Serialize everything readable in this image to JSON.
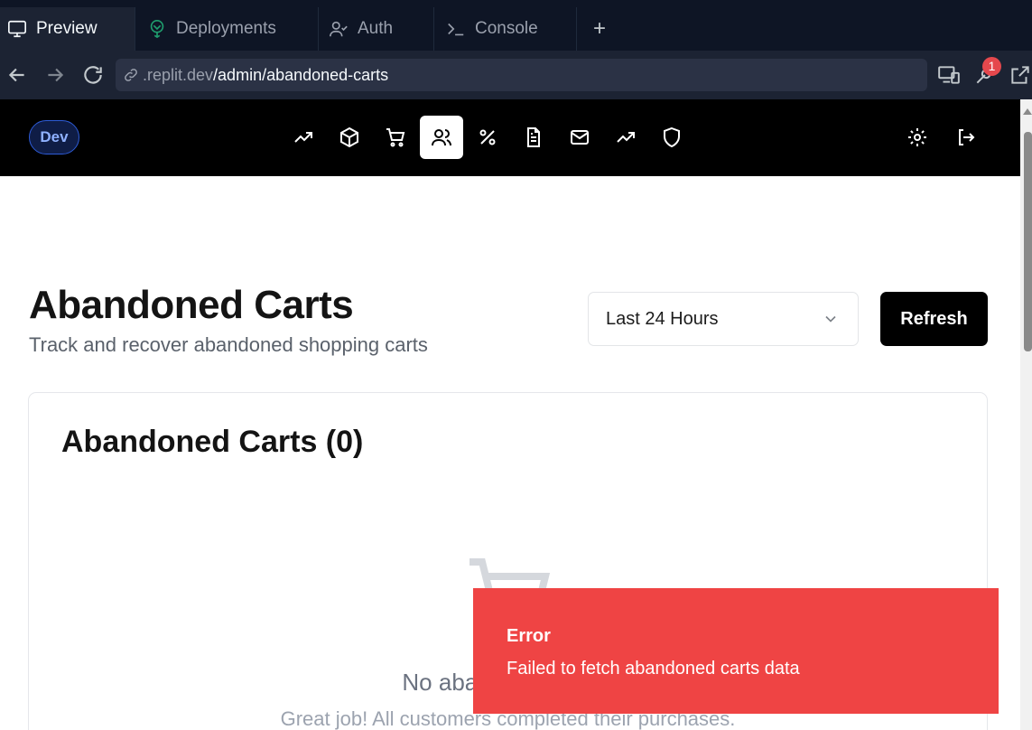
{
  "tabs": [
    {
      "label": "Preview",
      "icon": "monitor-icon",
      "active": true
    },
    {
      "label": "Deployments",
      "icon": "deploy-icon"
    },
    {
      "label": "Auth",
      "icon": "user-check-icon"
    },
    {
      "label": "Console",
      "icon": "terminal-icon"
    }
  ],
  "address": {
    "domain": ".replit.dev",
    "path": "/admin/abandoned-carts",
    "badge_count": "1"
  },
  "header": {
    "env_badge": "Dev",
    "nav_icons": [
      "trending-up-icon",
      "package-icon",
      "cart-icon",
      "users-icon",
      "percent-icon",
      "file-text-icon",
      "mail-icon",
      "trending-up-icon",
      "shield-icon"
    ],
    "active_nav": "users-icon"
  },
  "page": {
    "title": "Abandoned Carts",
    "subtitle": "Track and recover abandoned shopping carts",
    "range_select": {
      "value": "Last 24 Hours"
    },
    "refresh_label": "Refresh"
  },
  "card": {
    "title": "Abandoned Carts (0)",
    "empty_title": "No abandoned carts",
    "empty_subtitle": "Great job! All customers completed their purchases."
  },
  "toast": {
    "title": "Error",
    "message": "Failed to fetch abandoned carts data",
    "color": "#ef4444"
  }
}
